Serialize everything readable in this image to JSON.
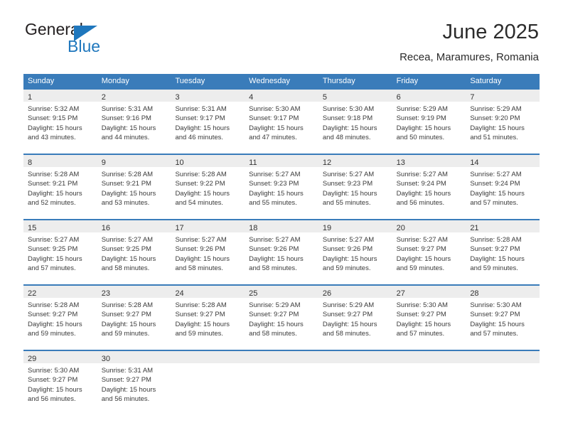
{
  "brand": {
    "name_top": "General",
    "name_bottom": "Blue",
    "triangle_color": "#1f77bd",
    "text_color": "#231f20"
  },
  "header": {
    "title": "June 2025",
    "subtitle": "Recea, Maramures, Romania"
  },
  "theme": {
    "header_bg": "#3a7cba",
    "header_text": "#ffffff",
    "day_band_bg": "#ededed",
    "row_divider": "#3a7cba",
    "body_text": "#3a3a3a"
  },
  "weekdays": [
    "Sunday",
    "Monday",
    "Tuesday",
    "Wednesday",
    "Thursday",
    "Friday",
    "Saturday"
  ],
  "weeks": [
    [
      {
        "day": "1",
        "sunrise": "Sunrise: 5:32 AM",
        "sunset": "Sunset: 9:15 PM",
        "daylight1": "Daylight: 15 hours",
        "daylight2": "and 43 minutes."
      },
      {
        "day": "2",
        "sunrise": "Sunrise: 5:31 AM",
        "sunset": "Sunset: 9:16 PM",
        "daylight1": "Daylight: 15 hours",
        "daylight2": "and 44 minutes."
      },
      {
        "day": "3",
        "sunrise": "Sunrise: 5:31 AM",
        "sunset": "Sunset: 9:17 PM",
        "daylight1": "Daylight: 15 hours",
        "daylight2": "and 46 minutes."
      },
      {
        "day": "4",
        "sunrise": "Sunrise: 5:30 AM",
        "sunset": "Sunset: 9:17 PM",
        "daylight1": "Daylight: 15 hours",
        "daylight2": "and 47 minutes."
      },
      {
        "day": "5",
        "sunrise": "Sunrise: 5:30 AM",
        "sunset": "Sunset: 9:18 PM",
        "daylight1": "Daylight: 15 hours",
        "daylight2": "and 48 minutes."
      },
      {
        "day": "6",
        "sunrise": "Sunrise: 5:29 AM",
        "sunset": "Sunset: 9:19 PM",
        "daylight1": "Daylight: 15 hours",
        "daylight2": "and 50 minutes."
      },
      {
        "day": "7",
        "sunrise": "Sunrise: 5:29 AM",
        "sunset": "Sunset: 9:20 PM",
        "daylight1": "Daylight: 15 hours",
        "daylight2": "and 51 minutes."
      }
    ],
    [
      {
        "day": "8",
        "sunrise": "Sunrise: 5:28 AM",
        "sunset": "Sunset: 9:21 PM",
        "daylight1": "Daylight: 15 hours",
        "daylight2": "and 52 minutes."
      },
      {
        "day": "9",
        "sunrise": "Sunrise: 5:28 AM",
        "sunset": "Sunset: 9:21 PM",
        "daylight1": "Daylight: 15 hours",
        "daylight2": "and 53 minutes."
      },
      {
        "day": "10",
        "sunrise": "Sunrise: 5:28 AM",
        "sunset": "Sunset: 9:22 PM",
        "daylight1": "Daylight: 15 hours",
        "daylight2": "and 54 minutes."
      },
      {
        "day": "11",
        "sunrise": "Sunrise: 5:27 AM",
        "sunset": "Sunset: 9:23 PM",
        "daylight1": "Daylight: 15 hours",
        "daylight2": "and 55 minutes."
      },
      {
        "day": "12",
        "sunrise": "Sunrise: 5:27 AM",
        "sunset": "Sunset: 9:23 PM",
        "daylight1": "Daylight: 15 hours",
        "daylight2": "and 55 minutes."
      },
      {
        "day": "13",
        "sunrise": "Sunrise: 5:27 AM",
        "sunset": "Sunset: 9:24 PM",
        "daylight1": "Daylight: 15 hours",
        "daylight2": "and 56 minutes."
      },
      {
        "day": "14",
        "sunrise": "Sunrise: 5:27 AM",
        "sunset": "Sunset: 9:24 PM",
        "daylight1": "Daylight: 15 hours",
        "daylight2": "and 57 minutes."
      }
    ],
    [
      {
        "day": "15",
        "sunrise": "Sunrise: 5:27 AM",
        "sunset": "Sunset: 9:25 PM",
        "daylight1": "Daylight: 15 hours",
        "daylight2": "and 57 minutes."
      },
      {
        "day": "16",
        "sunrise": "Sunrise: 5:27 AM",
        "sunset": "Sunset: 9:25 PM",
        "daylight1": "Daylight: 15 hours",
        "daylight2": "and 58 minutes."
      },
      {
        "day": "17",
        "sunrise": "Sunrise: 5:27 AM",
        "sunset": "Sunset: 9:26 PM",
        "daylight1": "Daylight: 15 hours",
        "daylight2": "and 58 minutes."
      },
      {
        "day": "18",
        "sunrise": "Sunrise: 5:27 AM",
        "sunset": "Sunset: 9:26 PM",
        "daylight1": "Daylight: 15 hours",
        "daylight2": "and 58 minutes."
      },
      {
        "day": "19",
        "sunrise": "Sunrise: 5:27 AM",
        "sunset": "Sunset: 9:26 PM",
        "daylight1": "Daylight: 15 hours",
        "daylight2": "and 59 minutes."
      },
      {
        "day": "20",
        "sunrise": "Sunrise: 5:27 AM",
        "sunset": "Sunset: 9:27 PM",
        "daylight1": "Daylight: 15 hours",
        "daylight2": "and 59 minutes."
      },
      {
        "day": "21",
        "sunrise": "Sunrise: 5:28 AM",
        "sunset": "Sunset: 9:27 PM",
        "daylight1": "Daylight: 15 hours",
        "daylight2": "and 59 minutes."
      }
    ],
    [
      {
        "day": "22",
        "sunrise": "Sunrise: 5:28 AM",
        "sunset": "Sunset: 9:27 PM",
        "daylight1": "Daylight: 15 hours",
        "daylight2": "and 59 minutes."
      },
      {
        "day": "23",
        "sunrise": "Sunrise: 5:28 AM",
        "sunset": "Sunset: 9:27 PM",
        "daylight1": "Daylight: 15 hours",
        "daylight2": "and 59 minutes."
      },
      {
        "day": "24",
        "sunrise": "Sunrise: 5:28 AM",
        "sunset": "Sunset: 9:27 PM",
        "daylight1": "Daylight: 15 hours",
        "daylight2": "and 59 minutes."
      },
      {
        "day": "25",
        "sunrise": "Sunrise: 5:29 AM",
        "sunset": "Sunset: 9:27 PM",
        "daylight1": "Daylight: 15 hours",
        "daylight2": "and 58 minutes."
      },
      {
        "day": "26",
        "sunrise": "Sunrise: 5:29 AM",
        "sunset": "Sunset: 9:27 PM",
        "daylight1": "Daylight: 15 hours",
        "daylight2": "and 58 minutes."
      },
      {
        "day": "27",
        "sunrise": "Sunrise: 5:30 AM",
        "sunset": "Sunset: 9:27 PM",
        "daylight1": "Daylight: 15 hours",
        "daylight2": "and 57 minutes."
      },
      {
        "day": "28",
        "sunrise": "Sunrise: 5:30 AM",
        "sunset": "Sunset: 9:27 PM",
        "daylight1": "Daylight: 15 hours",
        "daylight2": "and 57 minutes."
      }
    ],
    [
      {
        "day": "29",
        "sunrise": "Sunrise: 5:30 AM",
        "sunset": "Sunset: 9:27 PM",
        "daylight1": "Daylight: 15 hours",
        "daylight2": "and 56 minutes."
      },
      {
        "day": "30",
        "sunrise": "Sunrise: 5:31 AM",
        "sunset": "Sunset: 9:27 PM",
        "daylight1": "Daylight: 15 hours",
        "daylight2": "and 56 minutes."
      },
      {
        "day": "",
        "sunrise": "",
        "sunset": "",
        "daylight1": "",
        "daylight2": ""
      },
      {
        "day": "",
        "sunrise": "",
        "sunset": "",
        "daylight1": "",
        "daylight2": ""
      },
      {
        "day": "",
        "sunrise": "",
        "sunset": "",
        "daylight1": "",
        "daylight2": ""
      },
      {
        "day": "",
        "sunrise": "",
        "sunset": "",
        "daylight1": "",
        "daylight2": ""
      },
      {
        "day": "",
        "sunrise": "",
        "sunset": "",
        "daylight1": "",
        "daylight2": ""
      }
    ]
  ]
}
